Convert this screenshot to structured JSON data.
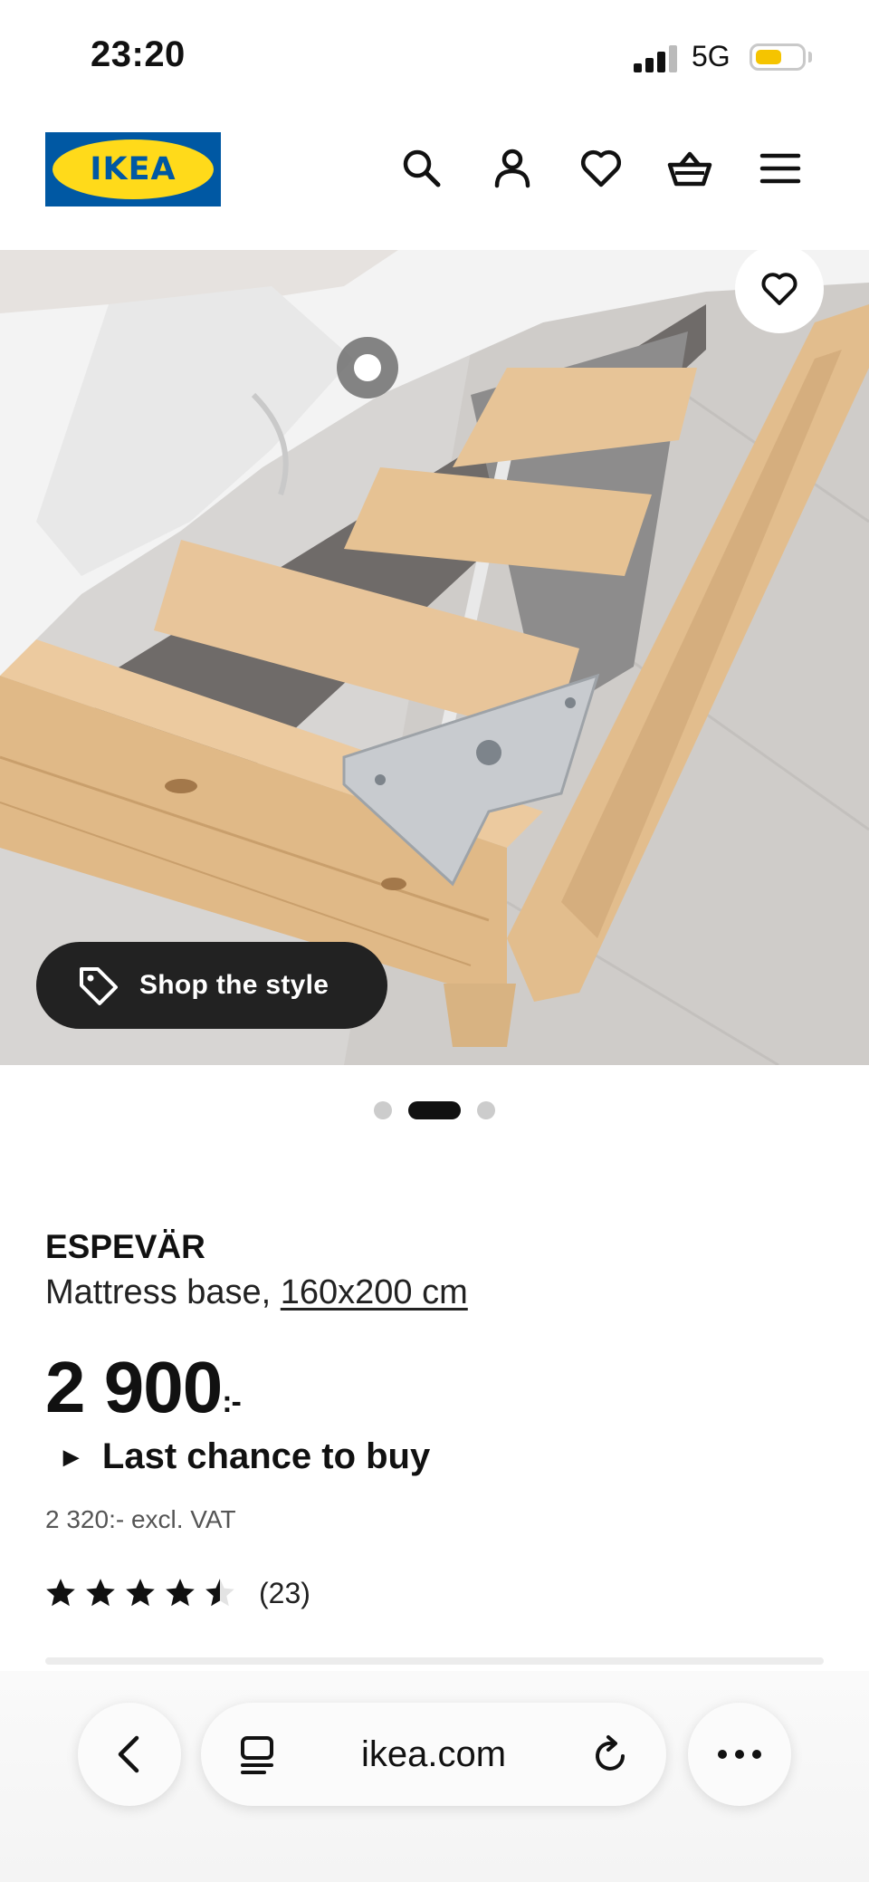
{
  "status_bar": {
    "time": "23:20",
    "network": "5G",
    "battery_color": "#f5c400",
    "battery_level": 0.55
  },
  "header": {
    "logo_text": "IKEA",
    "icons": [
      "search-icon",
      "account-icon",
      "wishlist-icon",
      "cart-icon",
      "menu-icon"
    ]
  },
  "gallery": {
    "shop_the_style_label": "Shop the style",
    "slide_count": 3,
    "active_slide": 2
  },
  "product": {
    "name": "ESPEVÄR",
    "description": "Mattress base, ",
    "size_link": "160x200 cm",
    "price": "2 900",
    "price_suffix": ":-",
    "last_chance_label": "Last chance to buy",
    "excl_vat": "2 320:- excl. VAT",
    "rating": 4.5,
    "review_count": "(23)"
  },
  "browser": {
    "url": "ikea.com"
  },
  "colors": {
    "ikea_blue": "#0058a3",
    "ikea_yellow": "#ffda1a",
    "pill_dark": "#222222"
  }
}
